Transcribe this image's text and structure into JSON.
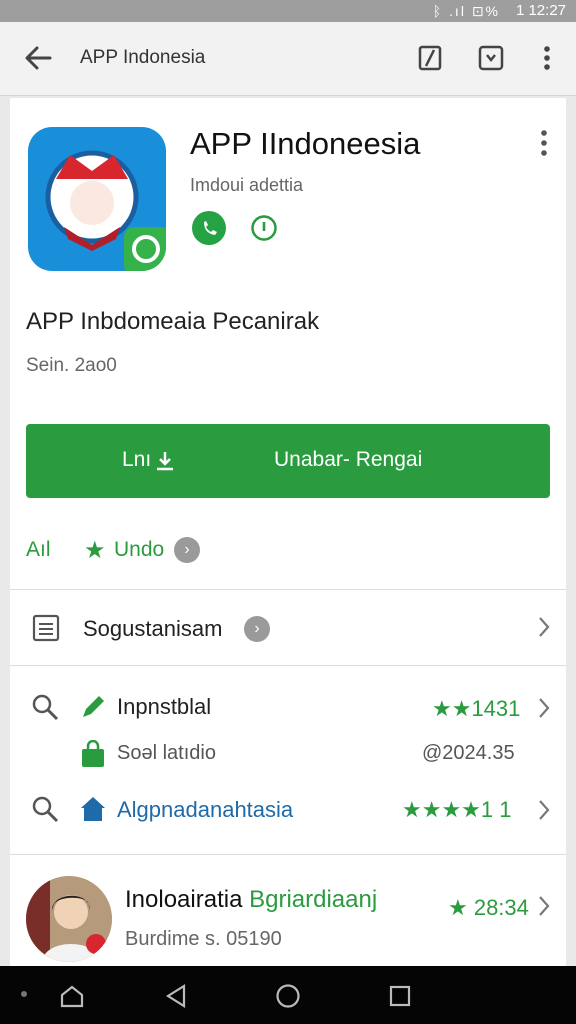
{
  "status_bar": {
    "icons": "ᛒ .ıl ⊡%",
    "time": "1 12:27"
  },
  "app_bar": {
    "title": "APP Indonesia"
  },
  "app": {
    "name": "APP IIndoneesia",
    "developer": "Imdoui adettia",
    "subtitle": "APP Inbdomeaia Pecanirak",
    "size": "Sein. 2ao0"
  },
  "install": {
    "left_label": "Lnı",
    "right_label": "Unabar- Rengai"
  },
  "rating_row": {
    "left_label": "Aıl",
    "star": "★",
    "right_label": "Undo",
    "info": "›"
  },
  "section": {
    "label": "Sogustanisam",
    "badge": "›"
  },
  "list": [
    {
      "label": "Inpnstblal",
      "stars": "★★1431",
      "sub_label": "Soəl latıdio",
      "sub_value": "@2024.35"
    },
    {
      "label": "Algpnadanahtasia",
      "stars": "★★★★1 1"
    }
  ],
  "review": {
    "name_black": "Inoloairatia",
    "name_green": "Bgriardiaanj",
    "stars": "★ 28:34",
    "meta": "Burdime s. 05190"
  },
  "colors": {
    "accent": "#2a9b3f",
    "icon_bg": "#1a8fd9",
    "link_blue": "#1f6aa8"
  }
}
